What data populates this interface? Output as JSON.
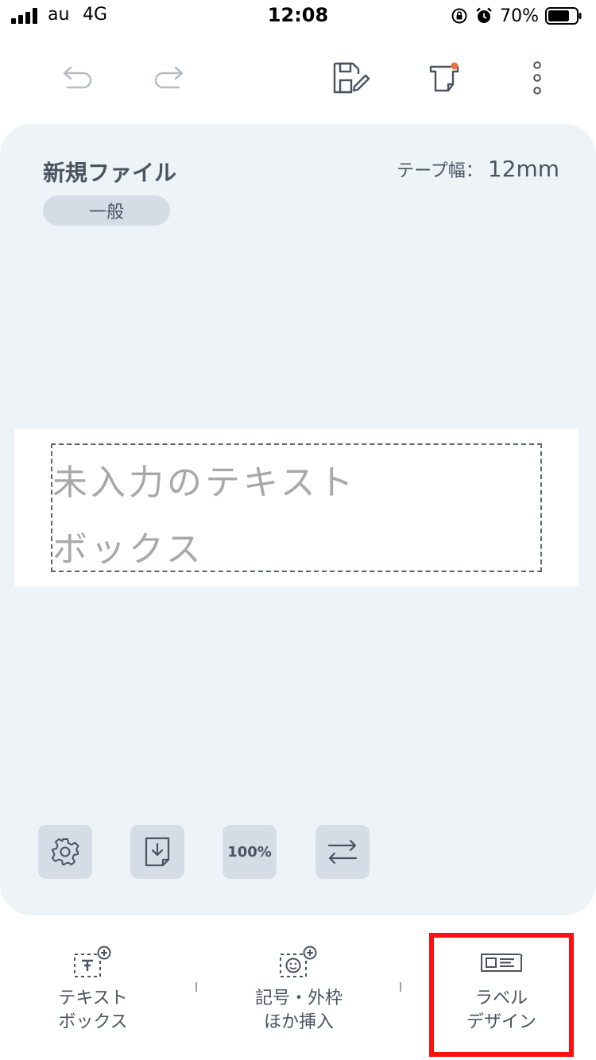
{
  "status_bar": {
    "carrier": "au",
    "network": "4G",
    "time": "12:08",
    "battery_percent": "70%",
    "icons": [
      "signal-bars-icon",
      "rotation-lock-icon",
      "alarm-icon",
      "battery-icon"
    ]
  },
  "toolbar": {
    "icons": [
      "undo-icon",
      "redo-icon",
      "save-edit-icon",
      "print-icon",
      "more-vertical-icon"
    ]
  },
  "document": {
    "file_name": "新規ファイル",
    "tape_width_label": "テープ幅：",
    "tape_width_value": "12mm",
    "category": "一般",
    "textbox_placeholder": "未入力のテキストボックス"
  },
  "canvas_tools": {
    "icons": [
      "settings-gear-icon",
      "import-document-icon",
      "zoom-level-icon",
      "swap-direction-icon"
    ],
    "zoom": "100%"
  },
  "bottom_nav": {
    "items": [
      {
        "label": "テキスト\nボックス",
        "icon": "add-text-box-icon"
      },
      {
        "label": "記号・外枠\nほか挿入",
        "icon": "add-symbol-icon"
      },
      {
        "label": "ラベル\nデザイン",
        "icon": "label-design-icon"
      }
    ]
  },
  "colors": {
    "accent_text": "#4a5360",
    "canvas_bg": "#eef3f8",
    "button_bg": "#d4dde6",
    "placeholder": "#a8a8a8",
    "highlight": "#ff0f0f"
  }
}
